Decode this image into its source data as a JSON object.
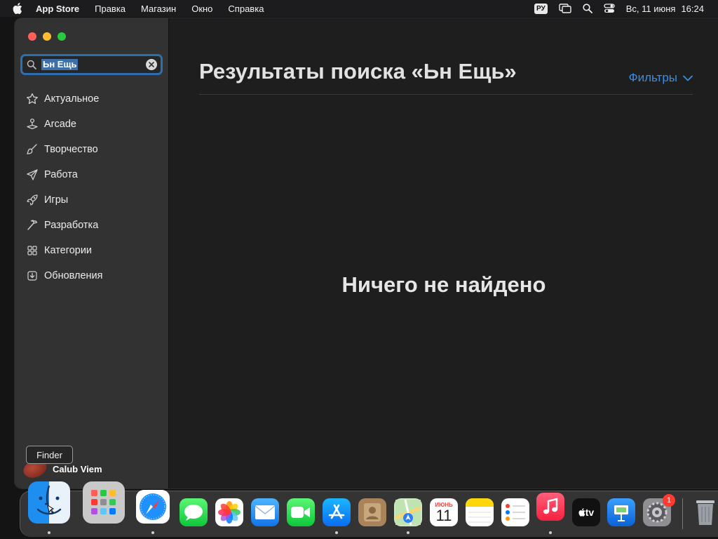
{
  "menubar": {
    "app_name": "App Store",
    "items": [
      "Правка",
      "Магазин",
      "Окно",
      "Справка"
    ],
    "input_source": "РУ",
    "date": "Вс, 11 июня",
    "time": "16:24"
  },
  "window": {
    "search": {
      "value": "Ьн Ещь",
      "icon": "magnifying-glass-icon"
    },
    "sidebar": {
      "items": [
        {
          "label": "Актуальное",
          "icon": "star-icon"
        },
        {
          "label": "Arcade",
          "icon": "joystick-icon"
        },
        {
          "label": "Творчество",
          "icon": "brush-icon"
        },
        {
          "label": "Работа",
          "icon": "paper-plane-icon"
        },
        {
          "label": "Игры",
          "icon": "rocket-icon"
        },
        {
          "label": "Разработка",
          "icon": "hammer-icon"
        },
        {
          "label": "Категории",
          "icon": "grid-icon"
        },
        {
          "label": "Обновления",
          "icon": "download-icon"
        }
      ],
      "user": {
        "name": "Calub Viem"
      }
    },
    "main": {
      "title": "Результаты поиска «Ьн Ещь»",
      "filters_label": "Фильтры",
      "empty_message": "Ничего не найдено"
    }
  },
  "tooltip": {
    "text": "Finder"
  },
  "dock": {
    "apps": [
      {
        "name": "Finder",
        "running": true
      },
      {
        "name": "Launchpad",
        "running": false
      },
      {
        "name": "Safari",
        "running": true
      },
      {
        "name": "Messages",
        "running": false
      },
      {
        "name": "Photos",
        "running": false
      },
      {
        "name": "Mail",
        "running": false
      },
      {
        "name": "FaceTime",
        "running": false
      },
      {
        "name": "App Store",
        "running": true
      },
      {
        "name": "Contacts",
        "running": false
      },
      {
        "name": "Maps",
        "running": true
      },
      {
        "name": "Calendar",
        "running": false
      },
      {
        "name": "Notes",
        "running": false
      },
      {
        "name": "Reminders",
        "running": false
      },
      {
        "name": "Music",
        "running": true
      },
      {
        "name": "TV",
        "running": false
      },
      {
        "name": "Keynote",
        "running": false
      },
      {
        "name": "System Settings",
        "running": false
      },
      {
        "name": "Trash",
        "running": false
      }
    ],
    "calendar": {
      "month": "ИЮНЬ",
      "day": "11"
    },
    "tv_label": "tv",
    "settings_badge": "1"
  }
}
